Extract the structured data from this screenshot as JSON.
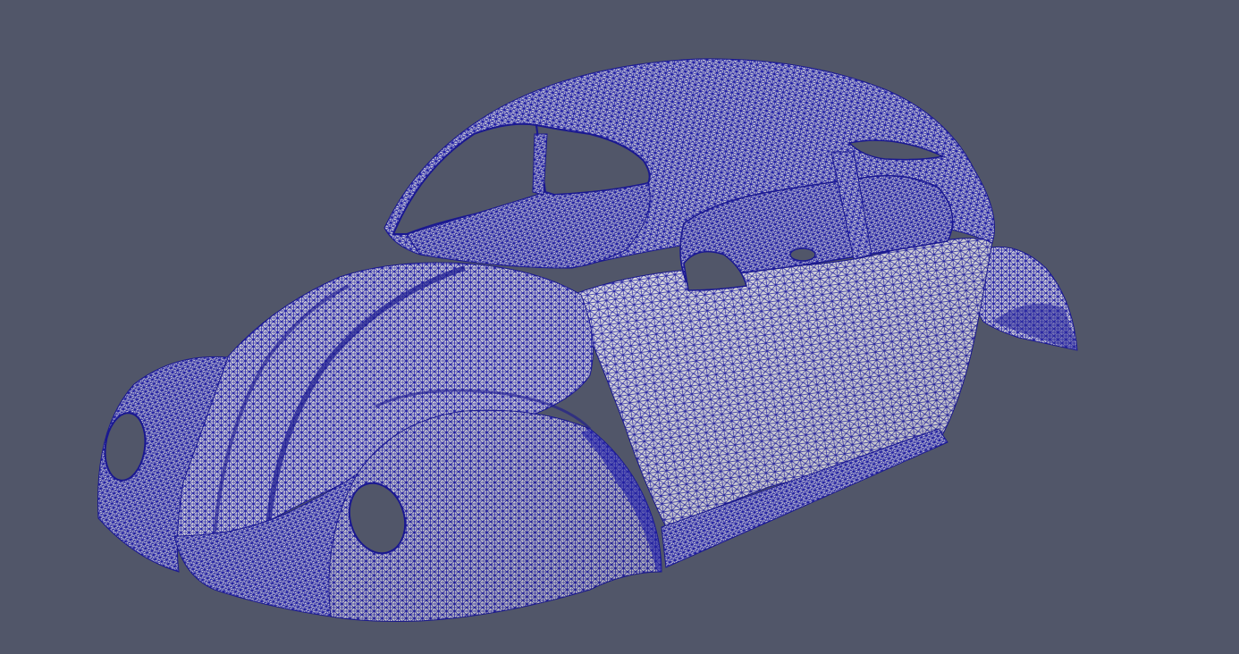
{
  "viewport": {
    "background_color": "#515669",
    "surface_color": "#d6d6d6",
    "mesh_line_color": "#1f1ea8",
    "representation": "surface-with-edges",
    "object": "car-body-mesh"
  }
}
